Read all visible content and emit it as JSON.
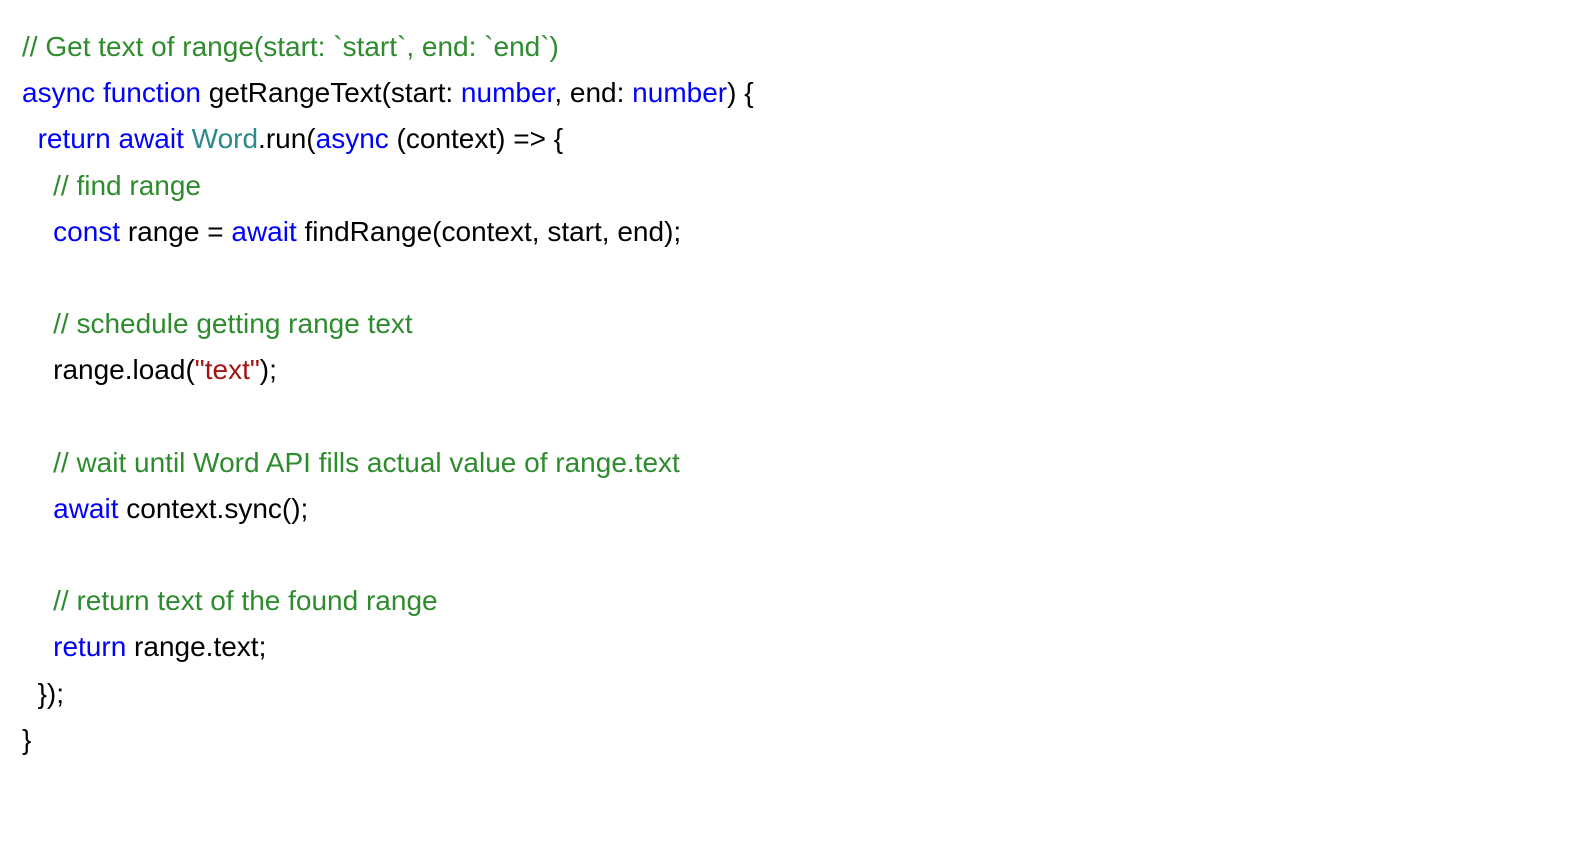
{
  "code": {
    "l1": {
      "c1": "// Get text of range(start: `start`, end: `end`)"
    },
    "l2": {
      "k1": "async",
      "sp1": " ",
      "k2": "function",
      "p1": " getRangeText(start: ",
      "k3": "number",
      "p2": ", end: ",
      "k4": "number",
      "p3": ") {"
    },
    "l3": {
      "i1": "  ",
      "k1": "return",
      "sp1": " ",
      "k2": "await",
      "sp2": " ",
      "t1": "Word",
      "p1": ".run(",
      "k3": "async",
      "p2": " (context) => {"
    },
    "l4": {
      "i1": "    ",
      "c1": "// find range"
    },
    "l5": {
      "i1": "    ",
      "k1": "const",
      "p1": " range = ",
      "k2": "await",
      "p2": " findRange(context, start, end);"
    },
    "l6": {
      "blank": ""
    },
    "l7": {
      "i1": "    ",
      "c1": "// schedule getting range text"
    },
    "l8": {
      "i1": "    ",
      "p1": "range.load(",
      "s1": "\"text\"",
      "p2": ");"
    },
    "l9": {
      "blank": ""
    },
    "l10": {
      "i1": "    ",
      "c1": "// wait until Word API fills actual value of range.text"
    },
    "l11": {
      "i1": "    ",
      "k1": "await",
      "p1": " context.sync();"
    },
    "l12": {
      "blank": ""
    },
    "l13": {
      "i1": "    ",
      "c1": "// return text of the found range"
    },
    "l14": {
      "i1": "    ",
      "k1": "return",
      "p1": " range.text;"
    },
    "l15": {
      "i1": "  ",
      "p1": "});"
    },
    "l16": {
      "p1": "}"
    }
  }
}
